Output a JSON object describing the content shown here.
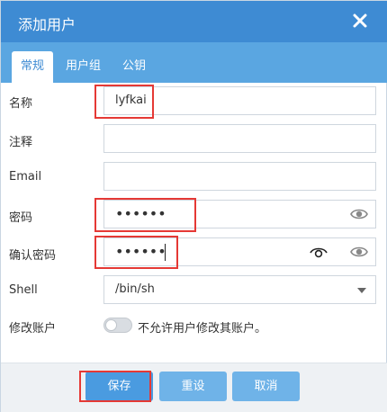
{
  "dialog": {
    "title": "添加用户",
    "close_icon": "close-icon"
  },
  "tabs": [
    {
      "label": "常规",
      "active": true
    },
    {
      "label": "用户组",
      "active": false
    },
    {
      "label": "公钥",
      "active": false
    }
  ],
  "form": {
    "name": {
      "label": "名称",
      "value": "lyfkai"
    },
    "comment": {
      "label": "注释",
      "value": ""
    },
    "email": {
      "label": "Email",
      "value": ""
    },
    "password": {
      "label": "密码",
      "value": "••••••"
    },
    "confirm_password": {
      "label": "确认密码",
      "value": "••••••"
    },
    "shell": {
      "label": "Shell",
      "value": "/bin/sh"
    },
    "modify_account": {
      "label": "修改账户",
      "toggle_text": "不允许用户修改其账户。",
      "enabled": false
    }
  },
  "footer": {
    "save_label": "保存",
    "reset_label": "重设",
    "cancel_label": "取消"
  },
  "colors": {
    "title_bar": "#3e8bd3",
    "tab_bar": "#5aa6e1",
    "button": "#6fb3e8",
    "highlight": "#e53935"
  }
}
